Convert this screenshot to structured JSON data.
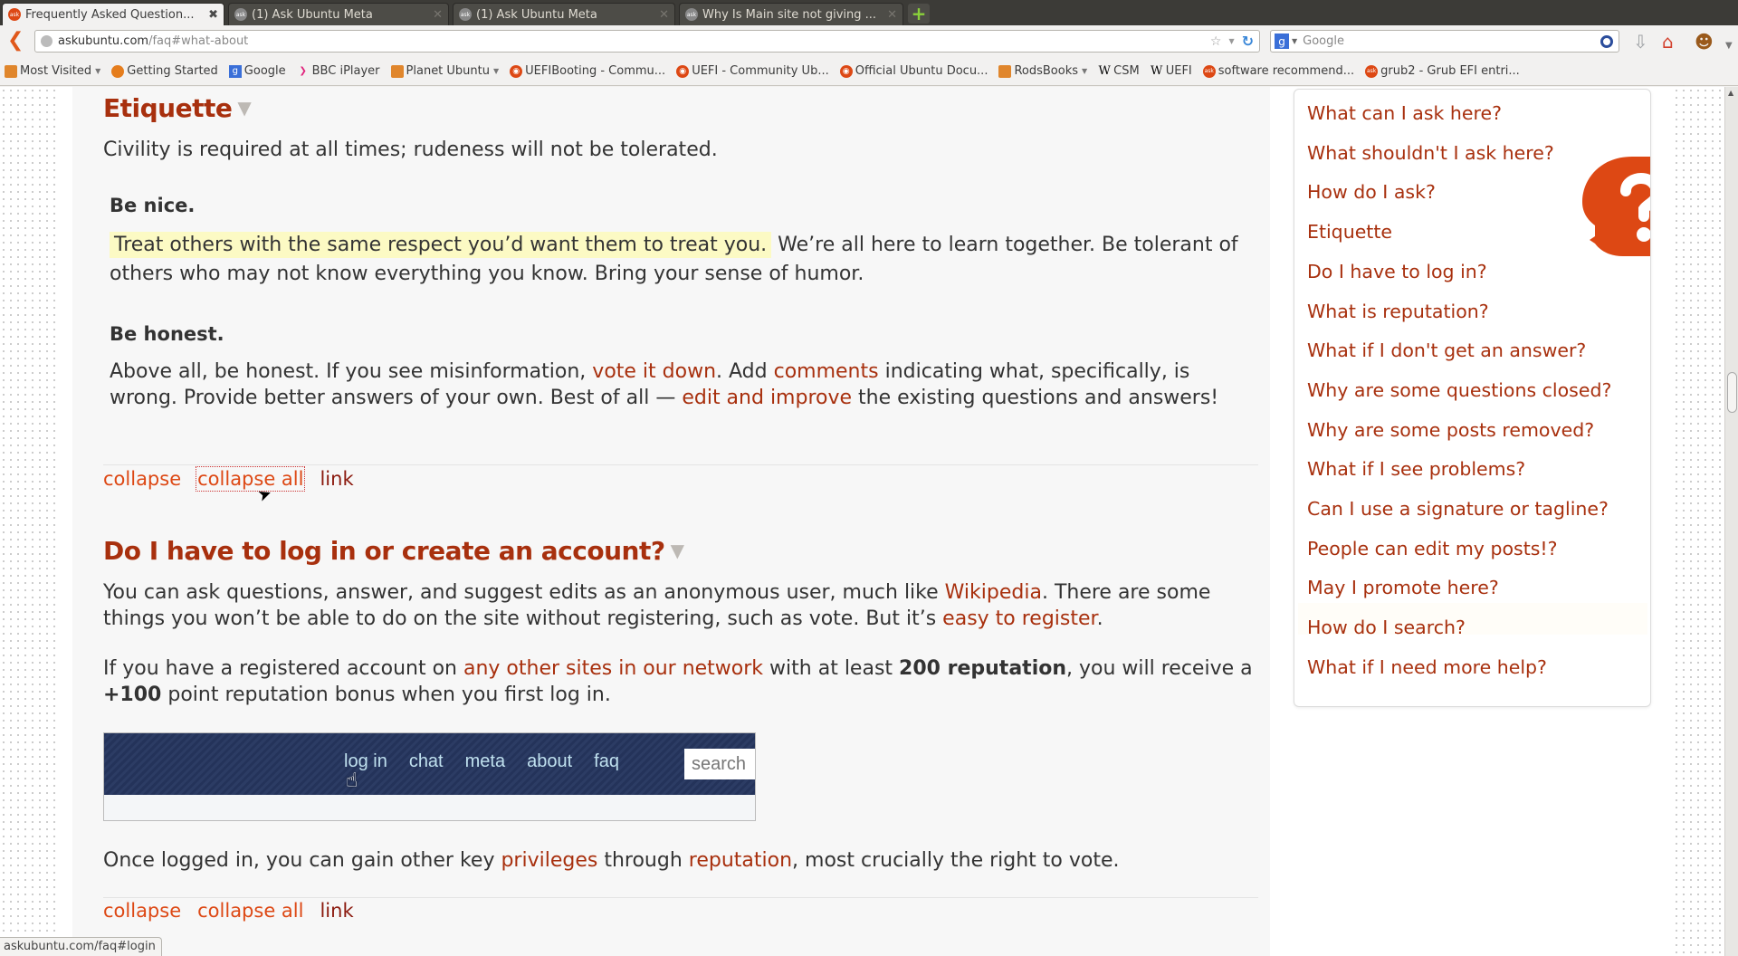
{
  "browser": {
    "tabs": [
      {
        "label": "Frequently Asked Question...",
        "favicon": "ask-icon",
        "active": true
      },
      {
        "label": "(1) Ask Ubuntu Meta",
        "favicon": "ask-icon",
        "active": false
      },
      {
        "label": "(1) Ask Ubuntu Meta",
        "favicon": "ask-icon",
        "active": false
      },
      {
        "label": "Why Is Main site not giving ...",
        "favicon": "ask-icon",
        "active": false
      }
    ],
    "new_tab_icon": "+",
    "url": {
      "host": "askubuntu.com",
      "path": "/faq#what-about"
    },
    "search_placeholder": "Google",
    "bookmarks": [
      {
        "label": "Most Visited",
        "icon": "folder-icon",
        "dropdown": true
      },
      {
        "label": "Getting Started",
        "icon": "firefox-icon",
        "dropdown": false
      },
      {
        "label": "Google",
        "icon": "google-icon",
        "dropdown": false
      },
      {
        "label": "BBC iPlayer",
        "icon": "bbc-icon",
        "dropdown": false
      },
      {
        "label": "Planet Ubuntu",
        "icon": "folder-icon",
        "dropdown": true
      },
      {
        "label": "UEFIBooting - Commu...",
        "icon": "ubuntu-icon",
        "dropdown": false
      },
      {
        "label": "UEFI - Community Ub...",
        "icon": "ubuntu-icon",
        "dropdown": false
      },
      {
        "label": "Official Ubuntu Docu...",
        "icon": "ubuntu-icon",
        "dropdown": false
      },
      {
        "label": "RodsBooks",
        "icon": "folder-icon",
        "dropdown": true
      },
      {
        "label": "CSM",
        "icon": "wikipedia-icon",
        "dropdown": false
      },
      {
        "label": "UEFI",
        "icon": "wikipedia-icon",
        "dropdown": false
      },
      {
        "label": "software recommend...",
        "icon": "ask-icon",
        "dropdown": false
      },
      {
        "label": "grub2 - Grub EFI entri...",
        "icon": "ask-icon",
        "dropdown": false
      }
    ],
    "status_text": "askubuntu.com/faq#login"
  },
  "etiquette": {
    "title": "Etiquette",
    "intro": "Civility is required at all times; rudeness will not be tolerated.",
    "nice": {
      "heading": "Be nice.",
      "highlight": "Treat others with the same respect you’d want them to treat you.",
      "rest": " We’re all here to learn together. Be tolerant of others who may not know everything you know. Bring your sense of humor."
    },
    "honest": {
      "heading": "Be honest.",
      "t1": "Above all, be honest. If you see misinformation, ",
      "link1": "vote it down",
      "t2": ". Add ",
      "link2": "comments",
      "t3": " indicating what, specifically, is wrong. Provide better answers of your own. Best of all — ",
      "link3": "edit and improve",
      "t4": " the existing questions and answers!"
    },
    "actions": {
      "collapse": "collapse",
      "collapse_all": "collapse all",
      "link": "link"
    }
  },
  "login_section": {
    "title": "Do I have to log in or create an account?",
    "p1": {
      "t1": "You can ask questions, answer, and suggest edits as an anonymous user, much like ",
      "link1": "Wikipedia",
      "t2": ". There are some things you won’t be able to do on the site without registering, such as vote. But it’s ",
      "link2": "easy to register",
      "t3": "."
    },
    "p2": {
      "t1": "If you have a registered account on ",
      "link1": "any other sites in our network",
      "t2": " with at least ",
      "bold1": "200 reputation",
      "t3": ", you will receive a ",
      "bold2": "+100",
      "t4": " point reputation bonus when you first log in."
    },
    "screenshot": {
      "nav": [
        "log in",
        "chat",
        "meta",
        "about",
        "faq"
      ],
      "search_placeholder": "search"
    },
    "p3": {
      "t1": "Once logged in, you can gain other key ",
      "link1": "privileges",
      "t2": " through ",
      "link2": "reputation",
      "t3": ", most crucially the right to vote."
    },
    "actions": {
      "collapse": "collapse",
      "collapse_all": "collapse all",
      "link": "link"
    }
  },
  "sidebar": {
    "items": [
      "What can I ask here?",
      "What shouldn't I ask here?",
      "How do I ask?",
      "Etiquette",
      "Do I have to log in?",
      "What is reputation?",
      "What if I don't get an answer?",
      "Why are some questions closed?",
      "Why are some posts removed?",
      "What if I see problems?",
      "Can I use a signature or tagline?",
      "People can edit my posts!?",
      "May I promote here?",
      "How do I search?",
      "What if I need more help?"
    ],
    "hovered_index": 13
  },
  "colors": {
    "brand": "#dd4814",
    "link": "#a8300e",
    "heading": "#a8300e",
    "highlight": "#fcfac4"
  }
}
